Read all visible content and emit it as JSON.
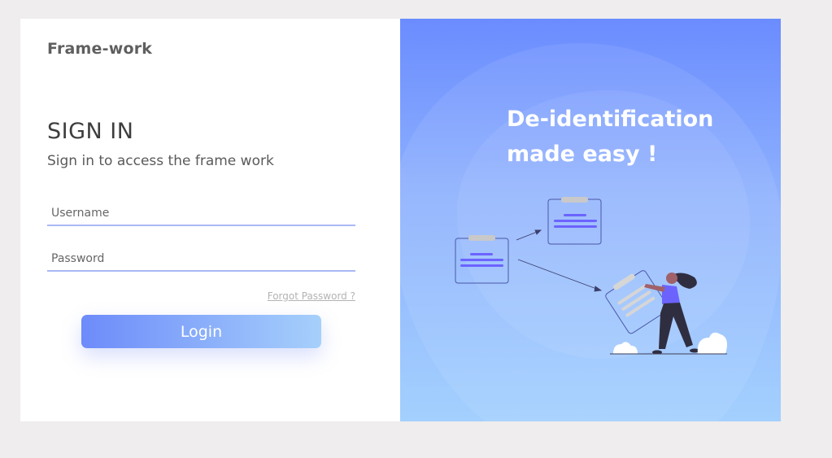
{
  "brand": "Frame-work",
  "signin": {
    "title": "SIGN IN",
    "subtitle": "Sign in to access the frame work",
    "username_placeholder": "Username",
    "password_placeholder": "Password",
    "forgot_label": "Forgot Password ?",
    "login_label": "Login"
  },
  "hero": {
    "headline_line1": "De-identification",
    "headline_line2": "made easy !"
  },
  "colors": {
    "accent_start": "#6d8bfa",
    "accent_end": "#a6d0fb",
    "panel_top": "#6a8cff",
    "panel_bottom": "#a3d0fe",
    "doc_line": "#6c63ff"
  },
  "icons": [
    "document-icon",
    "document-icon",
    "person-illustration"
  ]
}
